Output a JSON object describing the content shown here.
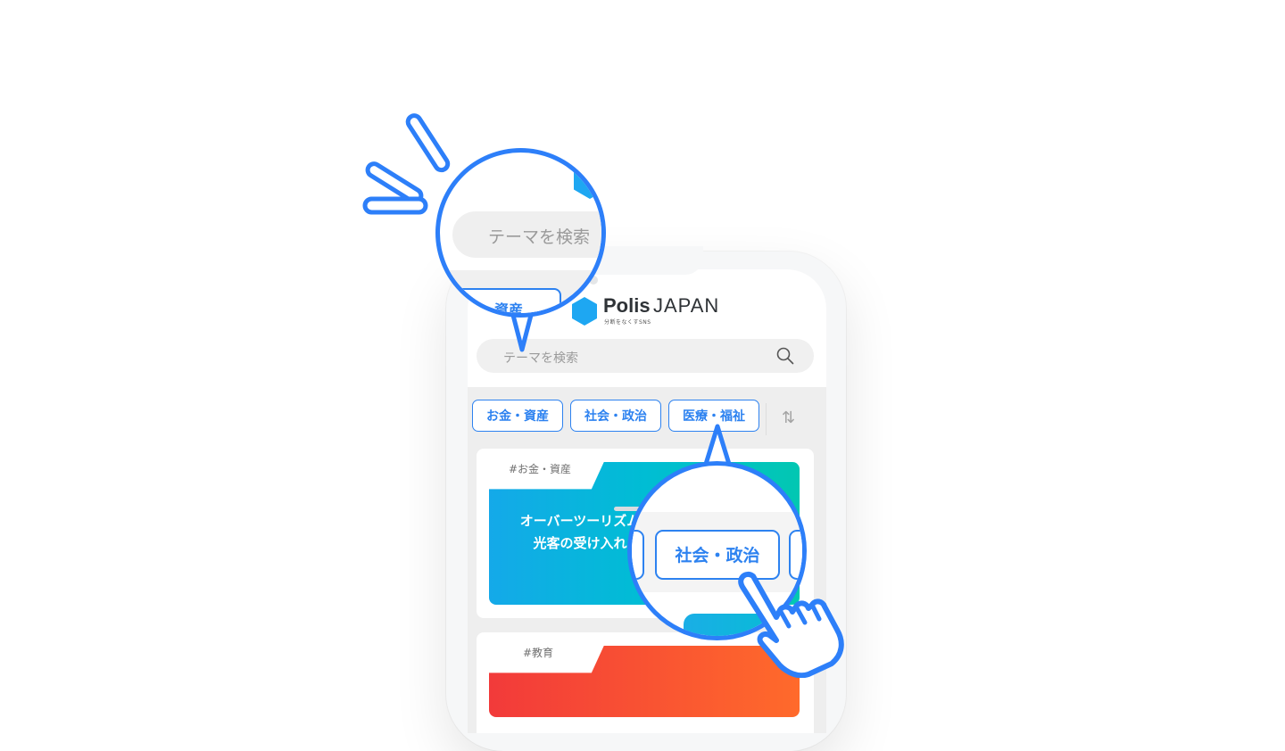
{
  "app": {
    "brand_bold": "Polis",
    "brand_light": "JAPAN",
    "tagline": "分断をなくすSNS",
    "search_placeholder": "テーマを検索"
  },
  "categories": [
    "お金・資産",
    "社会・政治",
    "医療・福祉"
  ],
  "cards": [
    {
      "tag": "#お金・資産",
      "title_line1": "オーバーツーリズム",
      "title_line2": "光客の受け入れ"
    },
    {
      "tag": "#教育"
    }
  ],
  "zoom_search": {
    "placeholder": "テーマを検索",
    "chip_label": "資産"
  },
  "zoom_chip": {
    "label": "社会・政治"
  },
  "colors": {
    "accent": "#2d82f0",
    "outline": "#2d7ff9",
    "card_a_gradient": [
      "#14a9e9",
      "#02c7b2"
    ],
    "card_b_gradient": [
      "#f23a3a",
      "#ff6a2b"
    ]
  },
  "icons": [
    "search-icon",
    "sort-icon",
    "sparkle-icon",
    "pointing-hand-icon"
  ]
}
